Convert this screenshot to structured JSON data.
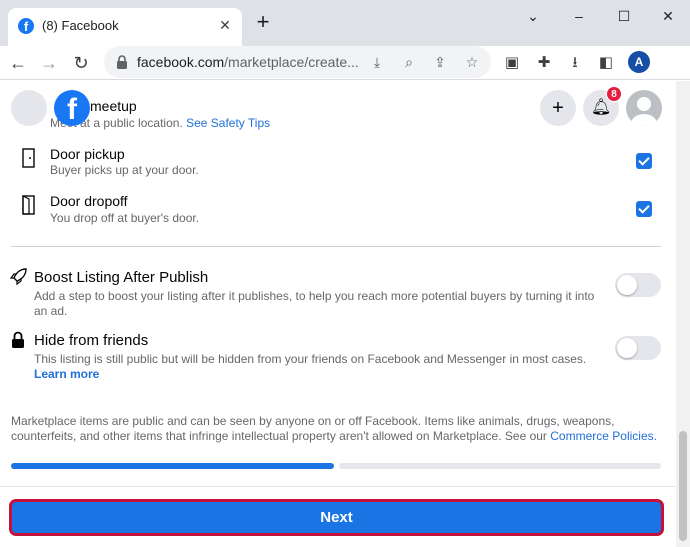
{
  "browser": {
    "tab_title": "(8) Facebook",
    "url_host": "facebook.com",
    "url_path": "/marketplace/create...",
    "profile_initial": "A"
  },
  "header": {
    "notification_count": "8"
  },
  "delivery": {
    "meetup_title": "Public meetup",
    "meetup_title_visible": "meetup",
    "meetup_sub_visible": "Meet at a public location.",
    "meetup_link": "See Safety Tips",
    "pickup_title": "Door pickup",
    "pickup_sub": "Buyer picks up at your door.",
    "dropoff_title": "Door dropoff",
    "dropoff_sub": "You drop off at buyer's door."
  },
  "options": {
    "boost_title": "Boost Listing After Publish",
    "boost_sub": "Add a step to boost your listing after it publishes, to help you reach more potential buyers by turning it into an ad.",
    "hide_title": "Hide from friends",
    "hide_sub": "This listing is still public but will be hidden from your friends on Facebook and Messenger in most cases.",
    "hide_link": "Learn more"
  },
  "footer": {
    "note": "Marketplace items are public and can be seen by anyone on or off Facebook. Items like animals, drugs, weapons, counterfeits, and other items that infringe intellectual property aren't allowed on Marketplace. See our",
    "note_link": "Commerce Policies."
  },
  "actions": {
    "next_label": "Next"
  },
  "progress": {
    "steps_completed": 1,
    "steps_total": 2
  },
  "colors": {
    "accent": "#1b74e4",
    "highlight_border": "#c4123a",
    "badge": "#e41e3f"
  }
}
